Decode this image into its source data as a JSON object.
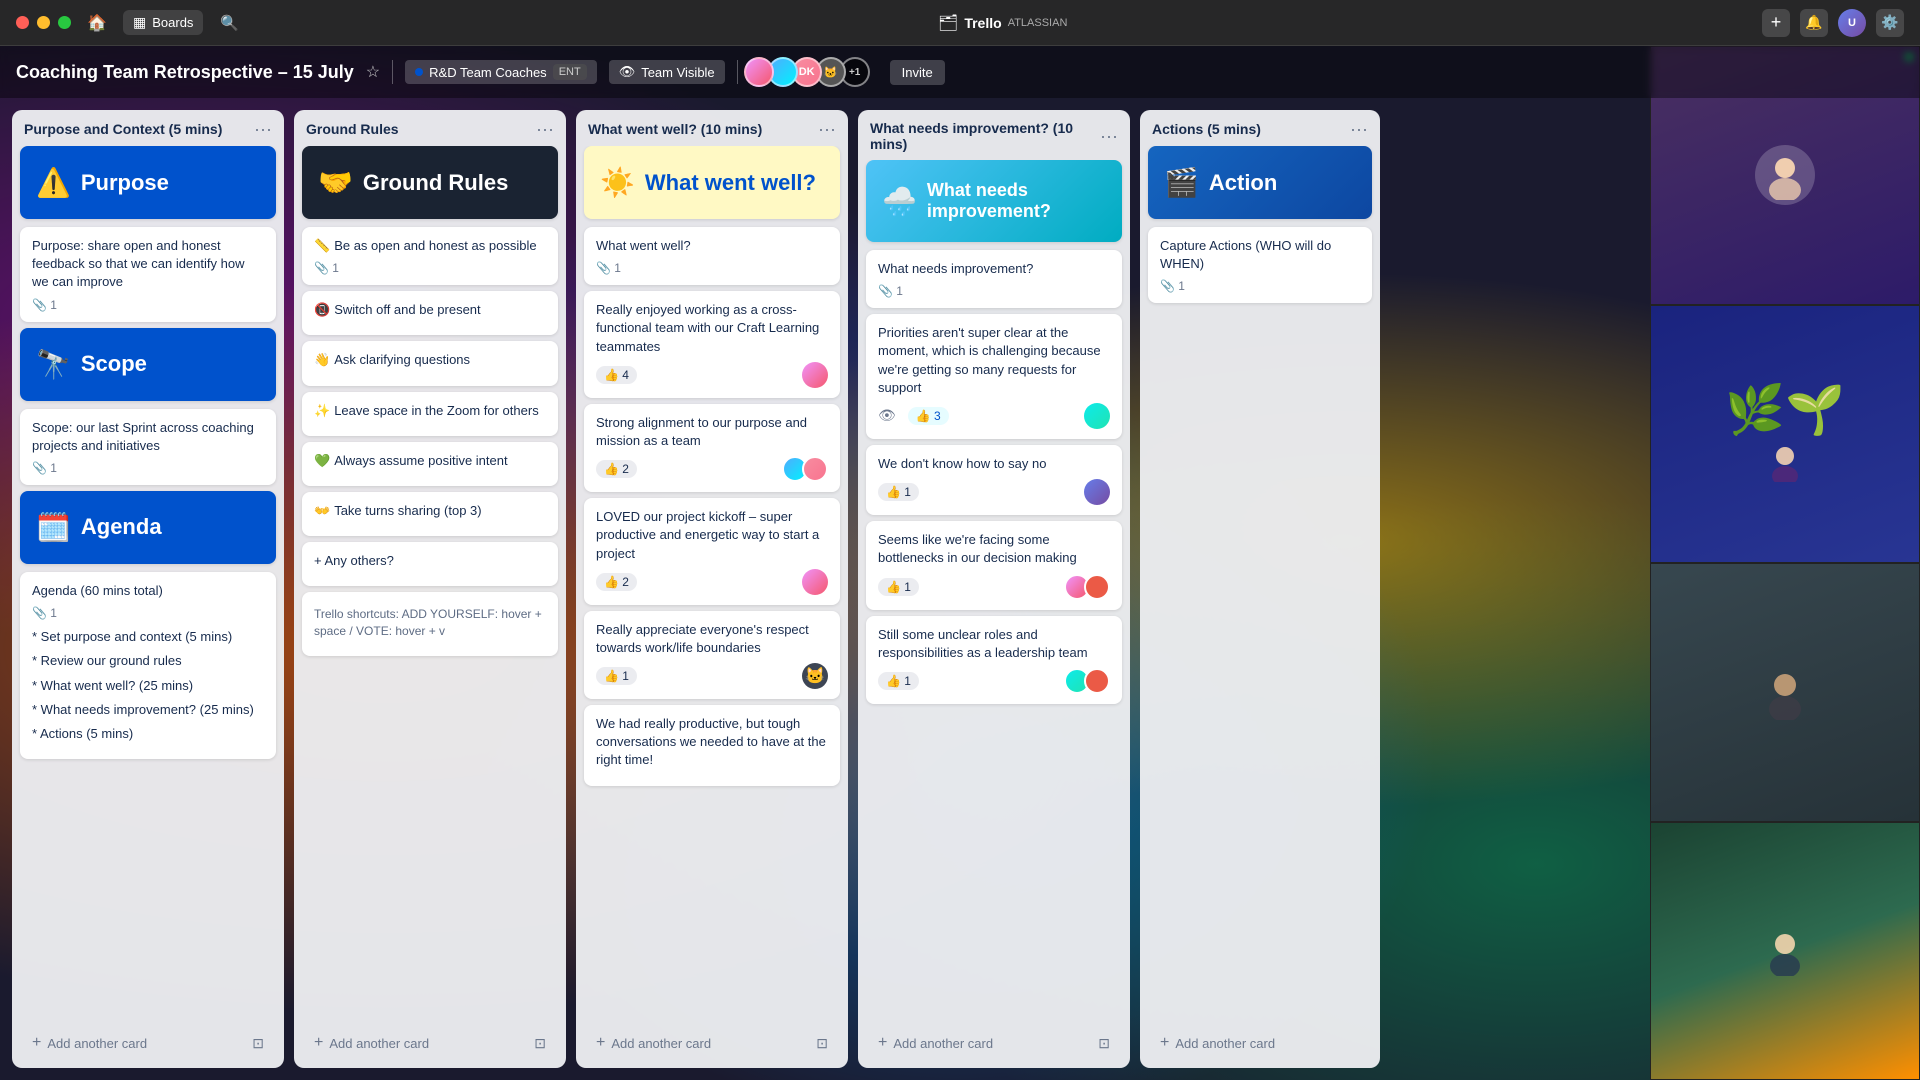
{
  "app": {
    "title": "Trello | Atlassian",
    "boards_label": "Boards"
  },
  "titlebar": {
    "home_icon": "🏠",
    "search_icon": "🔍",
    "boards_label": "Boards",
    "trello_label": "Trello",
    "atlassian_label": "ATLASSIAN",
    "add_icon": "+",
    "bell_icon": "🔔",
    "settings_icon": "⚙️"
  },
  "board": {
    "title": "Coaching Team Retrospective – 15 July",
    "star_icon": "⭐",
    "team_label": "R&D Team Coaches",
    "ent_label": "ENT",
    "visibility_label": "Team Visible",
    "invite_label": "Invite",
    "plus_one": "+1"
  },
  "lists": [
    {
      "id": "purpose",
      "title": "Purpose and Context (5 mins)",
      "cards": [
        {
          "type": "banner",
          "color": "blue",
          "emoji": "⚠️",
          "text": "Purpose",
          "attachments": null
        },
        {
          "type": "text",
          "text": "Purpose: share open and honest feedback so that we can identify how we can improve",
          "attachments": 1,
          "votes": null,
          "avatars": []
        },
        {
          "type": "banner",
          "color": "blue",
          "emoji": "🔭",
          "text": "Scope",
          "attachments": null
        },
        {
          "type": "text",
          "text": "Scope: our last Sprint across coaching projects and initiatives",
          "attachments": 1,
          "votes": null,
          "avatars": []
        },
        {
          "type": "banner",
          "color": "blue",
          "emoji": "🗓️",
          "text": "Agenda",
          "attachments": null
        },
        {
          "type": "text",
          "text": "Agenda (60 mins total)",
          "attachments": 1,
          "votes": null,
          "avatars": []
        },
        {
          "type": "agenda-item",
          "text": "* Set purpose and context (5 mins)"
        },
        {
          "type": "agenda-item",
          "text": "* Review our ground rules"
        },
        {
          "type": "agenda-item",
          "text": "* What went well? (25 mins)"
        },
        {
          "type": "agenda-item",
          "text": "* What needs improvement? (25 mins)"
        },
        {
          "type": "agenda-item",
          "text": "* Actions (5 mins)"
        }
      ],
      "add_label": "+ Add another card"
    },
    {
      "id": "ground-rules",
      "title": "Ground Rules",
      "cards": [
        {
          "type": "banner",
          "color": "dark",
          "emoji": "🤝",
          "text": "Ground Rules",
          "attachments": null
        },
        {
          "type": "rule",
          "emoji": "📏",
          "text": "Be as open and honest as possible",
          "attachments": 1
        },
        {
          "type": "rule",
          "emoji": "📵",
          "text": "Switch off and be present"
        },
        {
          "type": "rule",
          "emoji": "👋",
          "text": "Ask clarifying questions"
        },
        {
          "type": "rule",
          "emoji": "✨",
          "text": "Leave space in the Zoom for others"
        },
        {
          "type": "rule",
          "emoji": "💚",
          "text": "Always assume positive intent"
        },
        {
          "type": "rule",
          "emoji": "👐",
          "text": "Take turns sharing (top 3)"
        },
        {
          "type": "others",
          "text": "+ Any others?"
        },
        {
          "type": "shortcuts",
          "text": "Trello shortcuts: ADD YOURSELF: hover + space / VOTE: hover + v"
        }
      ],
      "add_label": "+ Add another card"
    },
    {
      "id": "went-well",
      "title": "What went well? (10 mins)",
      "cards": [
        {
          "type": "banner",
          "color": "yellow",
          "emoji": "☀️",
          "text": "What went well?",
          "textColor": "blue"
        },
        {
          "type": "text",
          "text": "What went well?",
          "attachments": 1,
          "votes": null,
          "avatars": []
        },
        {
          "type": "text",
          "text": "Really enjoyed working as a cross-functional team with our Craft Learning teammates",
          "attachments": null,
          "votes": 4,
          "votes_active": false,
          "avatars": [
            "av-orange"
          ]
        },
        {
          "type": "text",
          "text": "Strong alignment to our purpose and mission as a team",
          "attachments": null,
          "votes": 2,
          "votes_active": false,
          "avatars": [
            "av-blue",
            "av-pink"
          ]
        },
        {
          "type": "text",
          "text": "LOVED our project kickoff – super productive and energetic way to start a project",
          "attachments": null,
          "votes": 2,
          "votes_active": false,
          "avatars": [
            "av-orange"
          ]
        },
        {
          "type": "text",
          "text": "Really appreciate everyone's respect towards work/life boundaries",
          "attachments": null,
          "votes": 1,
          "votes_active": false,
          "avatars": [
            "av-dark"
          ]
        },
        {
          "type": "text",
          "text": "We had really productive, but tough conversations we needed to have at the right time!",
          "attachments": null,
          "votes": null,
          "avatars": []
        }
      ],
      "add_label": "+ Add another card"
    },
    {
      "id": "needs-improvement",
      "title": "What needs improvement? (10 mins)",
      "cards": [
        {
          "type": "banner",
          "color": "teal",
          "emoji": "🌧️",
          "text": "What needs improvement?",
          "textColor": "white"
        },
        {
          "type": "text",
          "text": "What needs improvement?",
          "attachments": 1,
          "votes": null,
          "avatars": []
        },
        {
          "type": "text",
          "text": "Priorities aren't super clear at the moment, which is challenging because we're getting so many requests for support",
          "attachments": null,
          "votes": 3,
          "votes_active": true,
          "show_eye": true,
          "avatars": [
            "av-teal"
          ]
        },
        {
          "type": "text",
          "text": "We don't know how to say no",
          "attachments": null,
          "votes": 1,
          "votes_active": false,
          "avatars": [
            "av-purple"
          ]
        },
        {
          "type": "text",
          "text": "Seems like we're facing some bottlenecks in our decision making",
          "attachments": null,
          "votes": 1,
          "votes_active": false,
          "avatars": [
            "av-orange",
            "av-red"
          ]
        },
        {
          "type": "text",
          "text": "Still some unclear roles and responsibilities as a leadership team",
          "attachments": null,
          "votes": 1,
          "votes_active": false,
          "avatars": [
            "av-teal",
            "av-red"
          ]
        }
      ],
      "add_label": "+ Add another card"
    },
    {
      "id": "actions",
      "title": "Actions (5 mins)",
      "cards": [
        {
          "type": "banner",
          "color": "partial",
          "emoji": "🎬",
          "text": "Action",
          "textColor": "white"
        },
        {
          "type": "text",
          "text": "Capture Actions (WHO will do WHEN)",
          "attachments": 1,
          "votes": null,
          "avatars": []
        }
      ],
      "add_label": "+ Add another card"
    }
  ],
  "video_participants": [
    {
      "id": 1,
      "bg": "bg1",
      "has_indicator": true
    },
    {
      "id": 2,
      "bg": "bg2",
      "has_indicator": false
    },
    {
      "id": 3,
      "bg": "bg3",
      "has_indicator": false
    },
    {
      "id": 4,
      "bg": "bg4",
      "has_indicator": false
    }
  ]
}
